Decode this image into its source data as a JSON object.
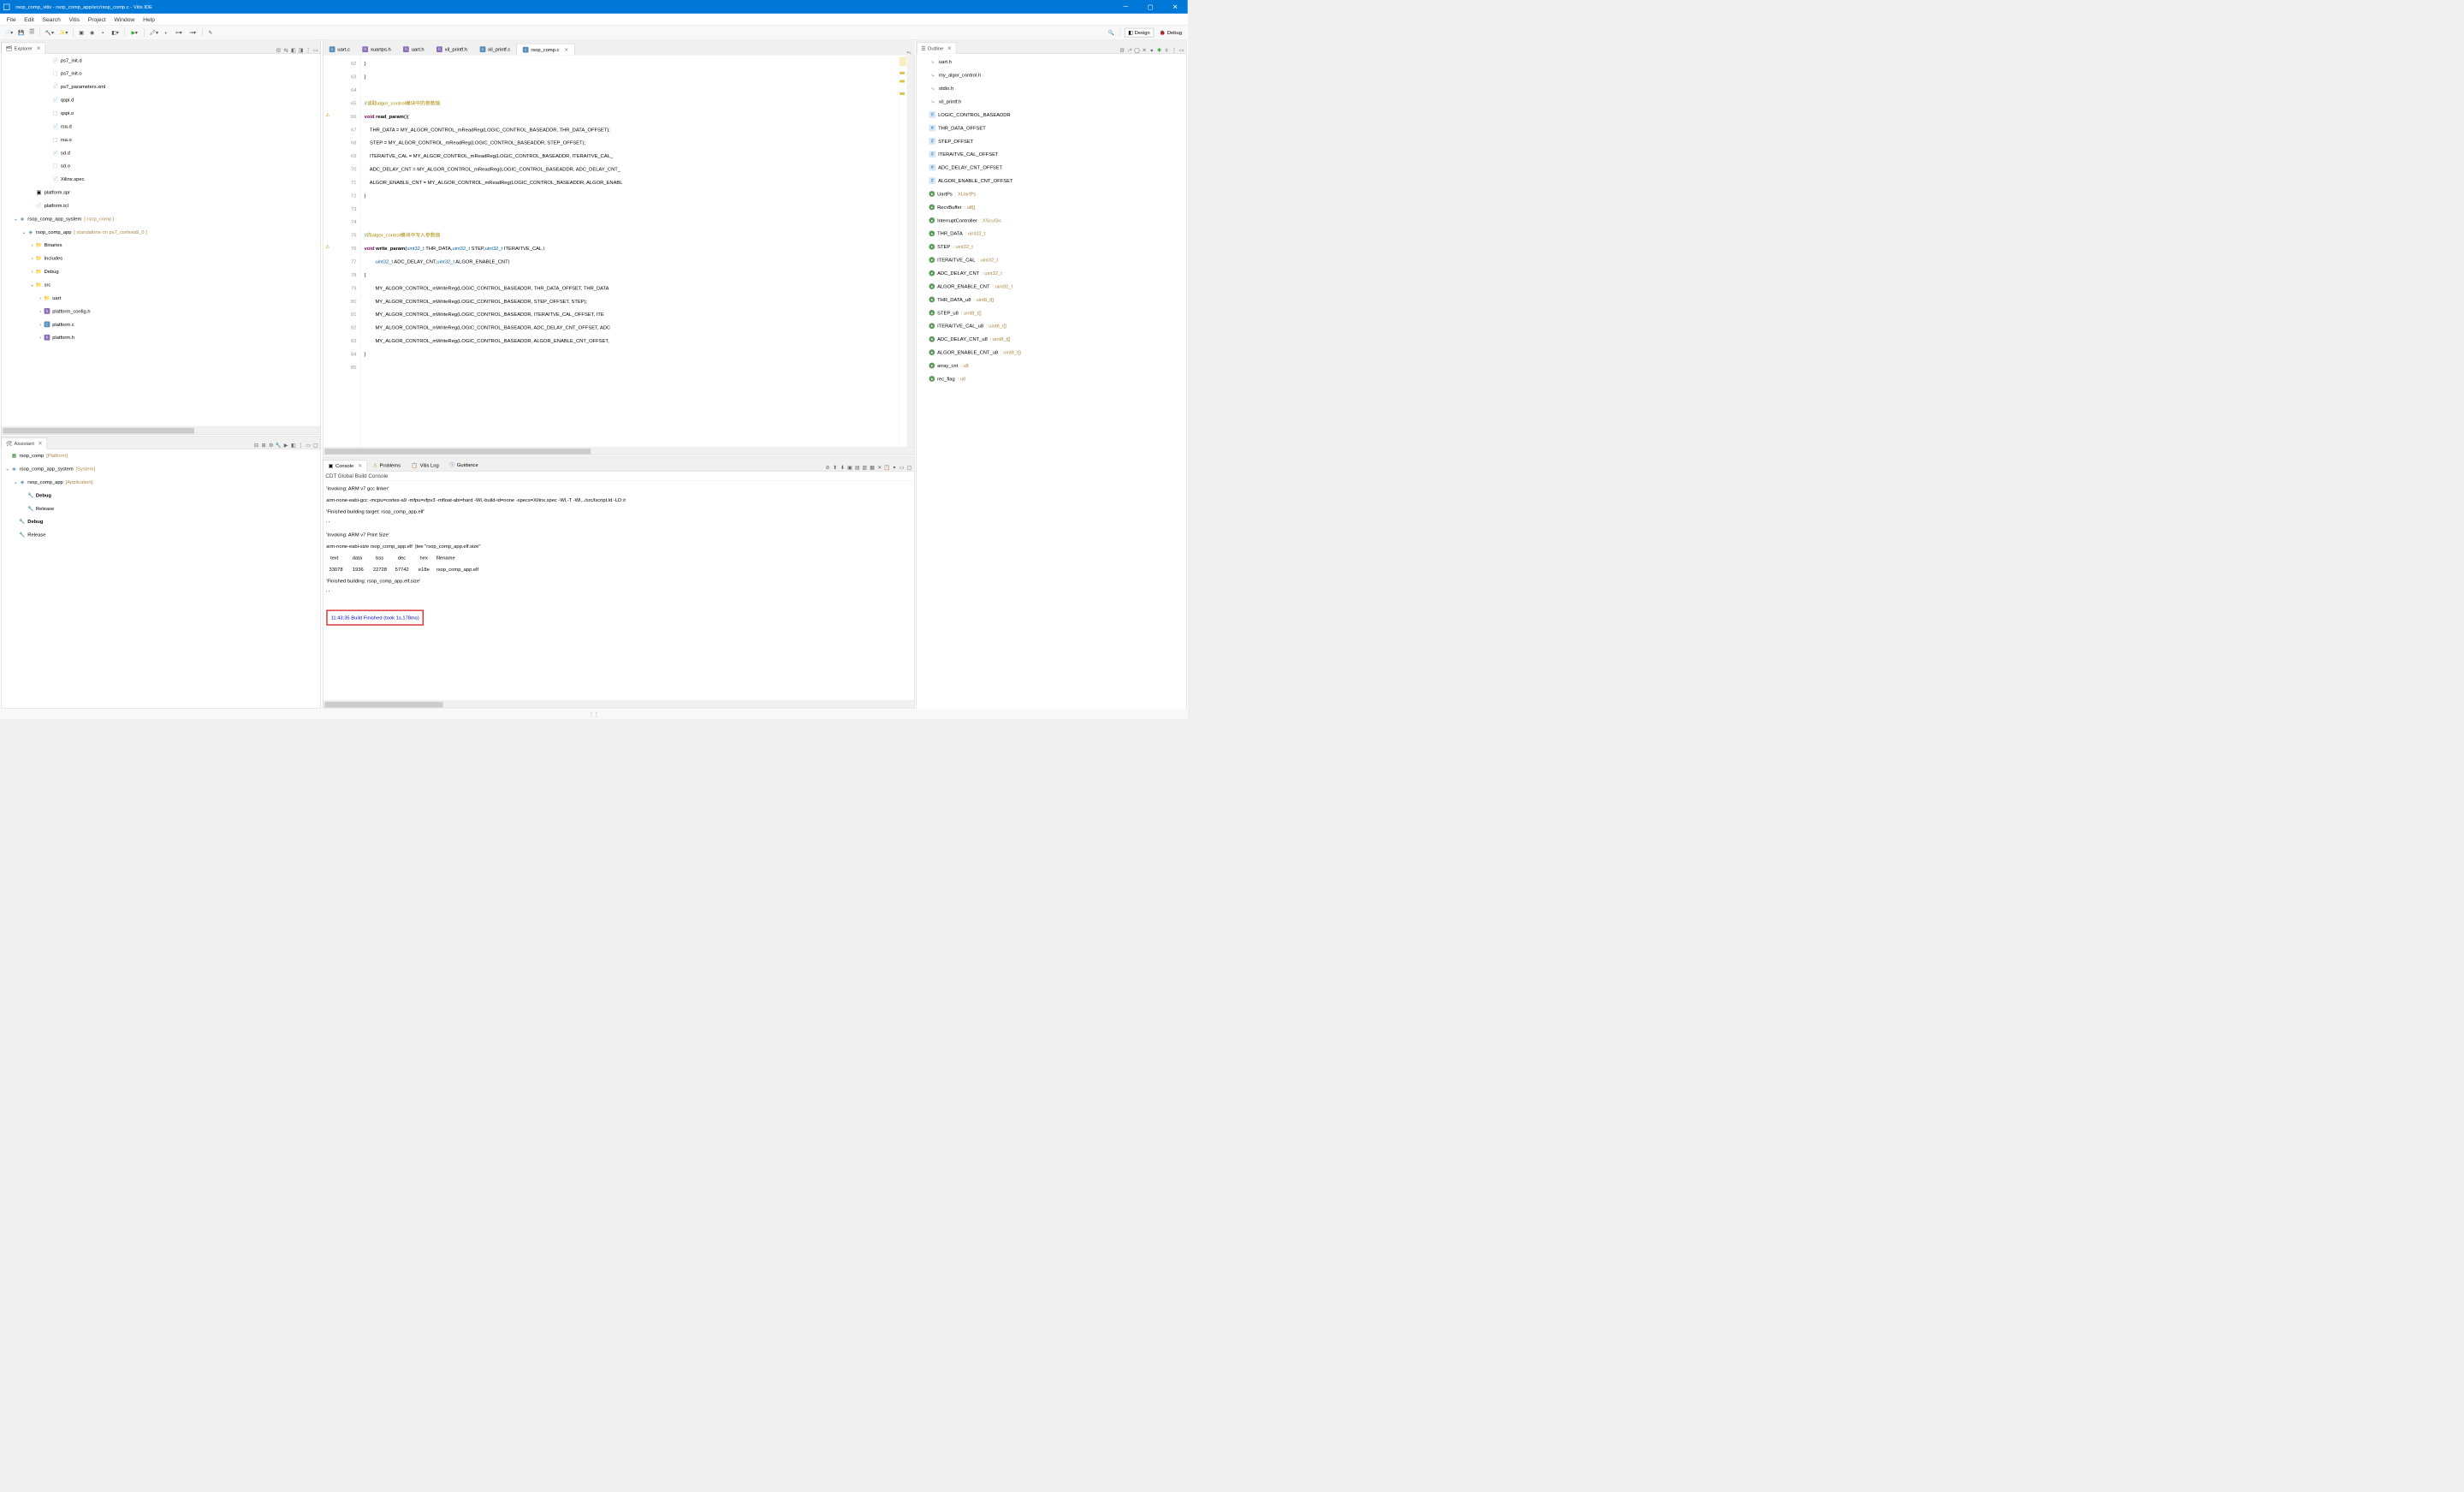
{
  "titlebar": "rsop_comp_vitis - rsop_comp_app/src/rsop_comp.c - Vitis IDE",
  "menu": [
    "File",
    "Edit",
    "Search",
    "Vitis",
    "Project",
    "Window",
    "Help"
  ],
  "perspectives": {
    "design": "Design",
    "debug": "Debug"
  },
  "explorer": {
    "title": "Explorer",
    "items": [
      {
        "indent": 5,
        "icon": "file",
        "label": "ps7_init.d"
      },
      {
        "indent": 5,
        "icon": "file-o",
        "label": "ps7_init.o"
      },
      {
        "indent": 5,
        "icon": "file",
        "label": "ps7_parameters.xml"
      },
      {
        "indent": 5,
        "icon": "file",
        "label": "qspi.d"
      },
      {
        "indent": 5,
        "icon": "file-o",
        "label": "qspi.o"
      },
      {
        "indent": 5,
        "icon": "file",
        "label": "rsa.d"
      },
      {
        "indent": 5,
        "icon": "file-o",
        "label": "rsa.o"
      },
      {
        "indent": 5,
        "icon": "file",
        "label": "sd.d"
      },
      {
        "indent": 5,
        "icon": "file-o",
        "label": "sd.o"
      },
      {
        "indent": 5,
        "icon": "file",
        "label": "Xilinx.spec"
      },
      {
        "indent": 3,
        "icon": "launch",
        "label": "platform.spr"
      },
      {
        "indent": 3,
        "icon": "file",
        "label": "platform.tcl"
      },
      {
        "indent": 1,
        "expand": "v",
        "icon": "project",
        "label": "rsop_comp_app_system",
        "suffix": "[ rsop_comp ]"
      },
      {
        "indent": 2,
        "expand": "v",
        "icon": "project",
        "label": "rsop_comp_app",
        "suffix": "[ standalone on ps7_cortexa9_0 ]"
      },
      {
        "indent": 3,
        "expand": ">",
        "icon": "folder",
        "label": "Binaries"
      },
      {
        "indent": 3,
        "expand": ">",
        "icon": "folder",
        "label": "Includes"
      },
      {
        "indent": 3,
        "expand": ">",
        "icon": "folder",
        "label": "Debug"
      },
      {
        "indent": 3,
        "expand": "v",
        "icon": "folder",
        "label": "src"
      },
      {
        "indent": 4,
        "expand": ">",
        "icon": "folder",
        "label": "uart"
      },
      {
        "indent": 4,
        "expand": ">",
        "icon": "file-h",
        "label": "platform_config.h"
      },
      {
        "indent": 4,
        "expand": ">",
        "icon": "file-c",
        "label": "platform.c"
      },
      {
        "indent": 4,
        "expand": ">",
        "icon": "file-h",
        "label": "platform.h"
      }
    ]
  },
  "assistant": {
    "title": "Assistant",
    "items": [
      {
        "indent": 0,
        "icon": "platform",
        "label": "rsop_comp",
        "suffix": "[Platform]"
      },
      {
        "indent": 0,
        "expand": "v",
        "icon": "project",
        "label": "rsop_comp_app_system",
        "suffix": "[System]"
      },
      {
        "indent": 1,
        "expand": "v",
        "icon": "project",
        "label": "rsop_comp_app",
        "suffix": "[Application]"
      },
      {
        "indent": 2,
        "icon": "wrench",
        "label": "Debug",
        "bold": true
      },
      {
        "indent": 2,
        "icon": "wrench",
        "label": "Release"
      },
      {
        "indent": 1,
        "icon": "wrench",
        "label": "Debug",
        "bold": true
      },
      {
        "indent": 1,
        "icon": "wrench",
        "label": "Release"
      }
    ]
  },
  "editor": {
    "tabs": [
      {
        "label": "uart.c",
        "icon": "c"
      },
      {
        "label": "xuartps.h",
        "icon": "h"
      },
      {
        "label": "uart.h",
        "icon": "h"
      },
      {
        "label": "xil_printf.h",
        "icon": "h"
      },
      {
        "label": "xil_printf.c",
        "icon": "c"
      },
      {
        "label": "rsop_comp.c",
        "icon": "c",
        "active": true,
        "close": true
      }
    ],
    "startLine": 62,
    "lines": [
      {
        "n": 62,
        "html": "}"
      },
      {
        "n": 63,
        "html": "}"
      },
      {
        "n": 64,
        "html": ""
      },
      {
        "n": 65,
        "html": "<span class='cmt'>//</span><span class='cmt-cn'>读取algor_control模块中的参数值</span>"
      },
      {
        "n": 66,
        "mark": "warn",
        "html": "<span class='kw'>void</span> <span class='fn'>read_param</span>(){"
      },
      {
        "n": 67,
        "html": "    THR_DATA = MY_ALGOR_CONTROL_mReadReg(LOGIC_CONTROL_BASEADDR, THR_DATA_OFFSET);"
      },
      {
        "n": 68,
        "html": "    STEP = MY_ALGOR_CONTROL_mReadReg(LOGIC_CONTROL_BASEADDR, STEP_OFFSET);"
      },
      {
        "n": 69,
        "html": "    ITERAITVE_CAL = MY_ALGOR_CONTROL_mReadReg(LOGIC_CONTROL_BASEADDR, ITERAITVE_CAL_"
      },
      {
        "n": 70,
        "html": "    ADC_DELAY_CNT = MY_ALGOR_CONTROL_mReadReg(LOGIC_CONTROL_BASEADDR, ADC_DELAY_CNT_"
      },
      {
        "n": 71,
        "html": "    ALGOR_ENABLE_CNT = MY_ALGOR_CONTROL_mReadReg(LOGIC_CONTROL_BASEADDR, ALGOR_ENABL"
      },
      {
        "n": 72,
        "html": "}"
      },
      {
        "n": 73,
        "html": ""
      },
      {
        "n": 74,
        "html": ""
      },
      {
        "n": 75,
        "html": "<span class='cmt'>//</span><span class='cmt-cn'>向algor_control模块中写入参数值</span>"
      },
      {
        "n": 76,
        "mark": "warn",
        "html": "<span class='kw'>void</span> <span class='fn'>write_param</span>(<span class='ty'>uint32_t</span> THR_DATA,<span class='ty'>uint32_t</span> STEP,<span class='ty'>uint32_t</span> ITERAITVE_CAL,\\"
      },
      {
        "n": 77,
        "html": "        <span class='ty'>uint32_t</span> ADC_DELAY_CNT,<span class='ty'>uint32_t</span> ALGOR_ENABLE_CNT)"
      },
      {
        "n": 78,
        "html": "{"
      },
      {
        "n": 79,
        "html": "        MY_ALGOR_CONTROL_mWriteReg(LOGIC_CONTROL_BASEADDR, THR_DATA_OFFSET, THR_DATA"
      },
      {
        "n": 80,
        "html": "        MY_ALGOR_CONTROL_mWriteReg(LOGIC_CONTROL_BASEADDR, STEP_OFFSET, STEP);"
      },
      {
        "n": 81,
        "html": "        MY_ALGOR_CONTROL_mWriteReg(LOGIC_CONTROL_BASEADDR, ITERAITVE_CAL_OFFSET, ITE"
      },
      {
        "n": 82,
        "html": "        MY_ALGOR_CONTROL_mWriteReg(LOGIC_CONTROL_BASEADDR, ADC_DELAY_CNT_OFFSET, ADC"
      },
      {
        "n": 83,
        "html": "        MY_ALGOR_CONTROL_mWriteReg(LOGIC_CONTROL_BASEADDR, ALGOR_ENABLE_CNT_OFFSET, "
      },
      {
        "n": 84,
        "html": "}"
      },
      {
        "n": 85,
        "html": ""
      }
    ]
  },
  "console": {
    "tabs": [
      {
        "label": "Console",
        "active": true,
        "icon": "console"
      },
      {
        "label": "Problems",
        "icon": "problems"
      },
      {
        "label": "Vitis Log",
        "icon": "log"
      },
      {
        "label": "Guidance",
        "icon": "guidance"
      }
    ],
    "subtitle": "CDT Global Build Console",
    "lines": [
      "'Invoking: ARM v7 gcc linker'",
      "arm-none-eabi-gcc -mcpu=cortex-a9 -mfpu=vfpv3 -mfloat-abi=hard -Wl,-build-id=none -specs=Xilinx.spec -Wl,-T -Wl,../src/lscript.ld -LD:/r",
      "'Finished building target: rsop_comp_app.elf'",
      "' '",
      "'Invoking: ARM v7 Print Size'",
      "arm-none-eabi-size rsop_comp_app.elf  |tee \"rsop_comp_app.elf.size\"",
      "   text\t   data\t    bss\t    dec\t    hex\tfilename",
      "  33078\t   1936\t  22728\t  57742\t   e18e\trsop_comp_app.elf",
      "'Finished building: rsop_comp_app.elf.size'",
      "' '"
    ],
    "buildFinished": "11:43:35 Build Finished (took 1s.178ms)"
  },
  "outline": {
    "title": "Outline",
    "items": [
      {
        "icon": "inc",
        "label": "uart.h"
      },
      {
        "icon": "inc",
        "label": "my_algor_control.h"
      },
      {
        "icon": "inc",
        "label": "stdio.h"
      },
      {
        "icon": "inc",
        "label": "xil_printf.h"
      },
      {
        "icon": "def",
        "label": "LOGIC_CONTROL_BASEADDR"
      },
      {
        "icon": "def",
        "label": "THR_DATA_OFFSET"
      },
      {
        "icon": "def",
        "label": "STEP_OFFSET"
      },
      {
        "icon": "def",
        "label": "ITERAITVE_CAL_OFFSET"
      },
      {
        "icon": "def",
        "label": "ADC_DELAY_CNT_OFFSET"
      },
      {
        "icon": "def",
        "label": "ALGOR_ENABLE_CNT_OFFSET"
      },
      {
        "icon": "var",
        "label": "UartPs",
        "suffix": ": XUartPs"
      },
      {
        "icon": "var",
        "label": "RecvBuffer",
        "suffix": ": u8[]"
      },
      {
        "icon": "var",
        "label": "InterruptController",
        "suffix": ": XScuGic"
      },
      {
        "icon": "var",
        "label": "THR_DATA",
        "suffix": ": uint32_t"
      },
      {
        "icon": "var",
        "label": "STEP",
        "suffix": ": uint32_t"
      },
      {
        "icon": "var",
        "label": "ITERAITVE_CAL",
        "suffix": ": uint32_t"
      },
      {
        "icon": "var",
        "label": "ADC_DELAY_CNT",
        "suffix": ": uint32_t"
      },
      {
        "icon": "var",
        "label": "ALGOR_ENABLE_CNT",
        "suffix": ": uint32_t"
      },
      {
        "icon": "var",
        "label": "THR_DATA_u8",
        "suffix": ": uint8_t[]"
      },
      {
        "icon": "var",
        "label": "STEP_u8",
        "suffix": ": uint8_t[]"
      },
      {
        "icon": "var",
        "label": "ITERAITVE_CAL_u8",
        "suffix": ": uint8_t[]"
      },
      {
        "icon": "var",
        "label": "ADC_DELAY_CNT_u8",
        "suffix": ": uint8_t[]"
      },
      {
        "icon": "var",
        "label": "ALGOR_ENABLE_CNT_u8",
        "suffix": ": uint8_t[]"
      },
      {
        "icon": "var",
        "label": "array_cnt",
        "suffix": ": u8"
      },
      {
        "icon": "var",
        "label": "rec_flag",
        "suffix": ": u8"
      }
    ]
  }
}
